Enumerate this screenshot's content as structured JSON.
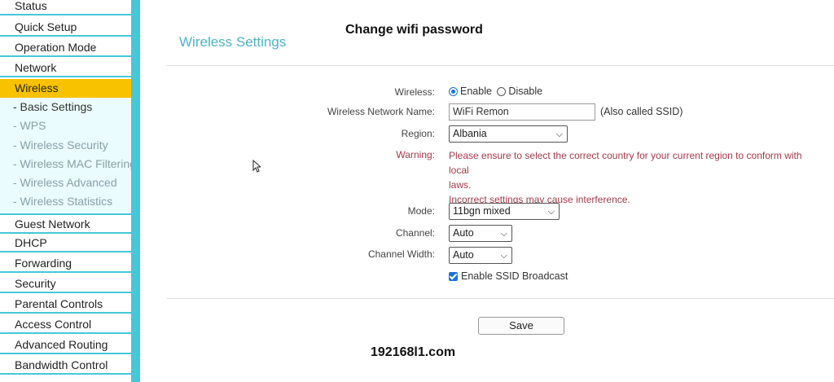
{
  "banner": {
    "title": "Change wifi password",
    "domain": "192168l1.com"
  },
  "sidebar": {
    "items_top": [
      "Status",
      "Quick Setup",
      "Operation Mode",
      "Network"
    ],
    "active": "Wireless",
    "subitems": [
      "- Basic Settings",
      "- WPS",
      "- Wireless Security",
      "- Wireless MAC Filtering",
      "- Wireless Advanced",
      "- Wireless Statistics"
    ],
    "items_bottom": [
      "Guest Network",
      "DHCP",
      "Forwarding",
      "Security",
      "Parental Controls",
      "Access Control",
      "Advanced Routing",
      "Bandwidth Control"
    ]
  },
  "main": {
    "title": "Wireless Settings",
    "wireless": {
      "label": "Wireless:",
      "enable": "Enable",
      "disable": "Disable",
      "selected": "Enable"
    },
    "network_name": {
      "label": "Wireless Network Name:",
      "value": "WiFi Remon",
      "hint": "(Also called SSID)"
    },
    "region": {
      "label": "Region:",
      "value": "Albania"
    },
    "warning": {
      "label": "Warning:",
      "line1": "Please ensure to select the correct country for your current region to conform with local",
      "line2": "laws.",
      "line3": "Incorrect settings may cause interference."
    },
    "mode": {
      "label": "Mode:",
      "value": "11bgn mixed"
    },
    "channel": {
      "label": "Channel:",
      "value": "Auto"
    },
    "channel_width": {
      "label": "Channel Width:",
      "value": "Auto"
    },
    "ssid_broadcast": {
      "label": "Enable SSID Broadcast",
      "checked": true
    },
    "save_label": "Save"
  },
  "colors": {
    "accent": "#45c8d8",
    "active": "#f9c200",
    "title": "#4fb3c2",
    "warning": "#a33a48"
  },
  "icons": {
    "dropdown": "chevron-down-icon",
    "cursor": "mouse-pointer-icon"
  }
}
